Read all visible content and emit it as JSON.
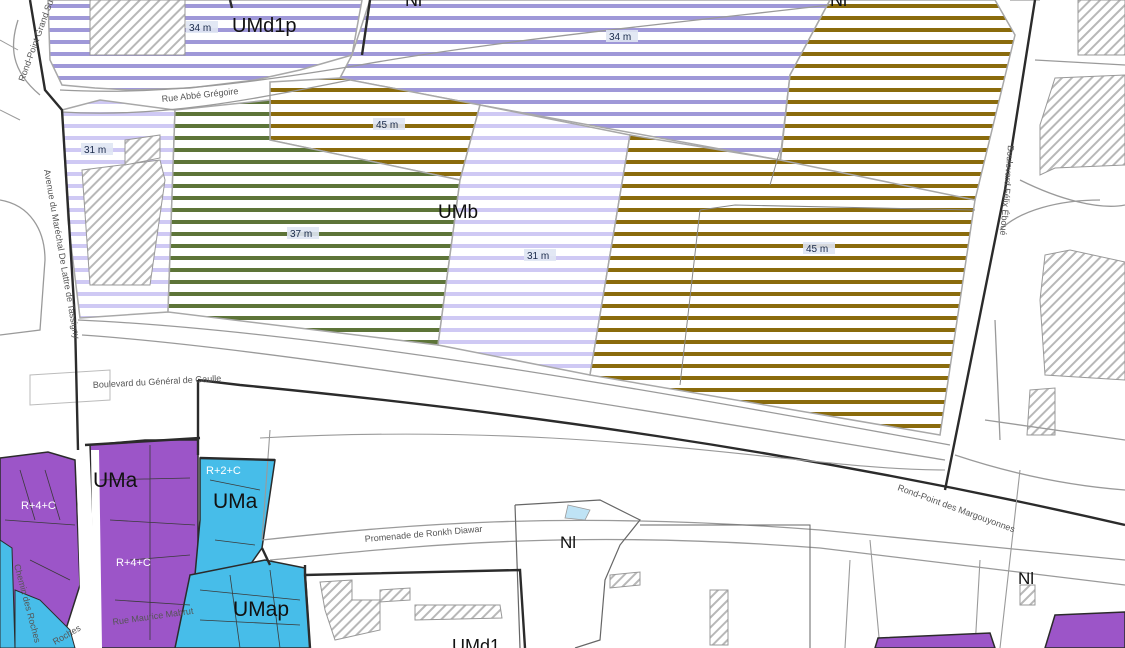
{
  "colors": {
    "purple_band": "#9f98d8",
    "purple_light_band": "#cfc9f4",
    "olive_band": "#8a6b0c",
    "green_band": "#5d7438",
    "uma_purple": "#9c55c8",
    "umap_blue": "#47bde9",
    "zone_line": "#2b2b2b",
    "road_line": "#9a9a9a",
    "hatch": "#b8b8b8"
  },
  "zones": {
    "umd1p": "UMd1p",
    "nl_top_left": "Nl",
    "nl_top_right": "Nl",
    "umb": "UMb",
    "uma_left": "UMa",
    "uma_right": "UMa",
    "umap": "UMap",
    "nl_mid": "Nl",
    "nl_right": "Nl",
    "umd_bottom": "UMd1"
  },
  "heights": {
    "h34_left": "34 m",
    "h34_right": "34 m",
    "h45_top": "45 m",
    "h31_left": "31 m",
    "h37": "37 m",
    "h31_mid": "31 m",
    "h45_right": "45 m"
  },
  "floor_limits": {
    "r2c": "R+2+C",
    "r4c_left": "R+4+C",
    "r4c_mid": "R+4+C"
  },
  "streets": {
    "rue_abbe_gregoire": "Rue Abbé Grégoire",
    "boulevard_general": "Boulevard du Général de Gaulle",
    "promenade": "Promenade de Ronkh Diawar",
    "rond_point_margouyonnes": "Rond-Point des Margouyonnes",
    "avenue_marechal": "Avenue du Maréchal De Lattre de Tassigny",
    "rond_point_grand_sud": "Rond-Point Grand Sud",
    "boulevard_right": "Boulevard Félix Éboué",
    "rue_maurice": "Rue Maurice Mabrut",
    "chemin_roches": "Chemin des Roches",
    "roches_bottom": "Roches"
  }
}
